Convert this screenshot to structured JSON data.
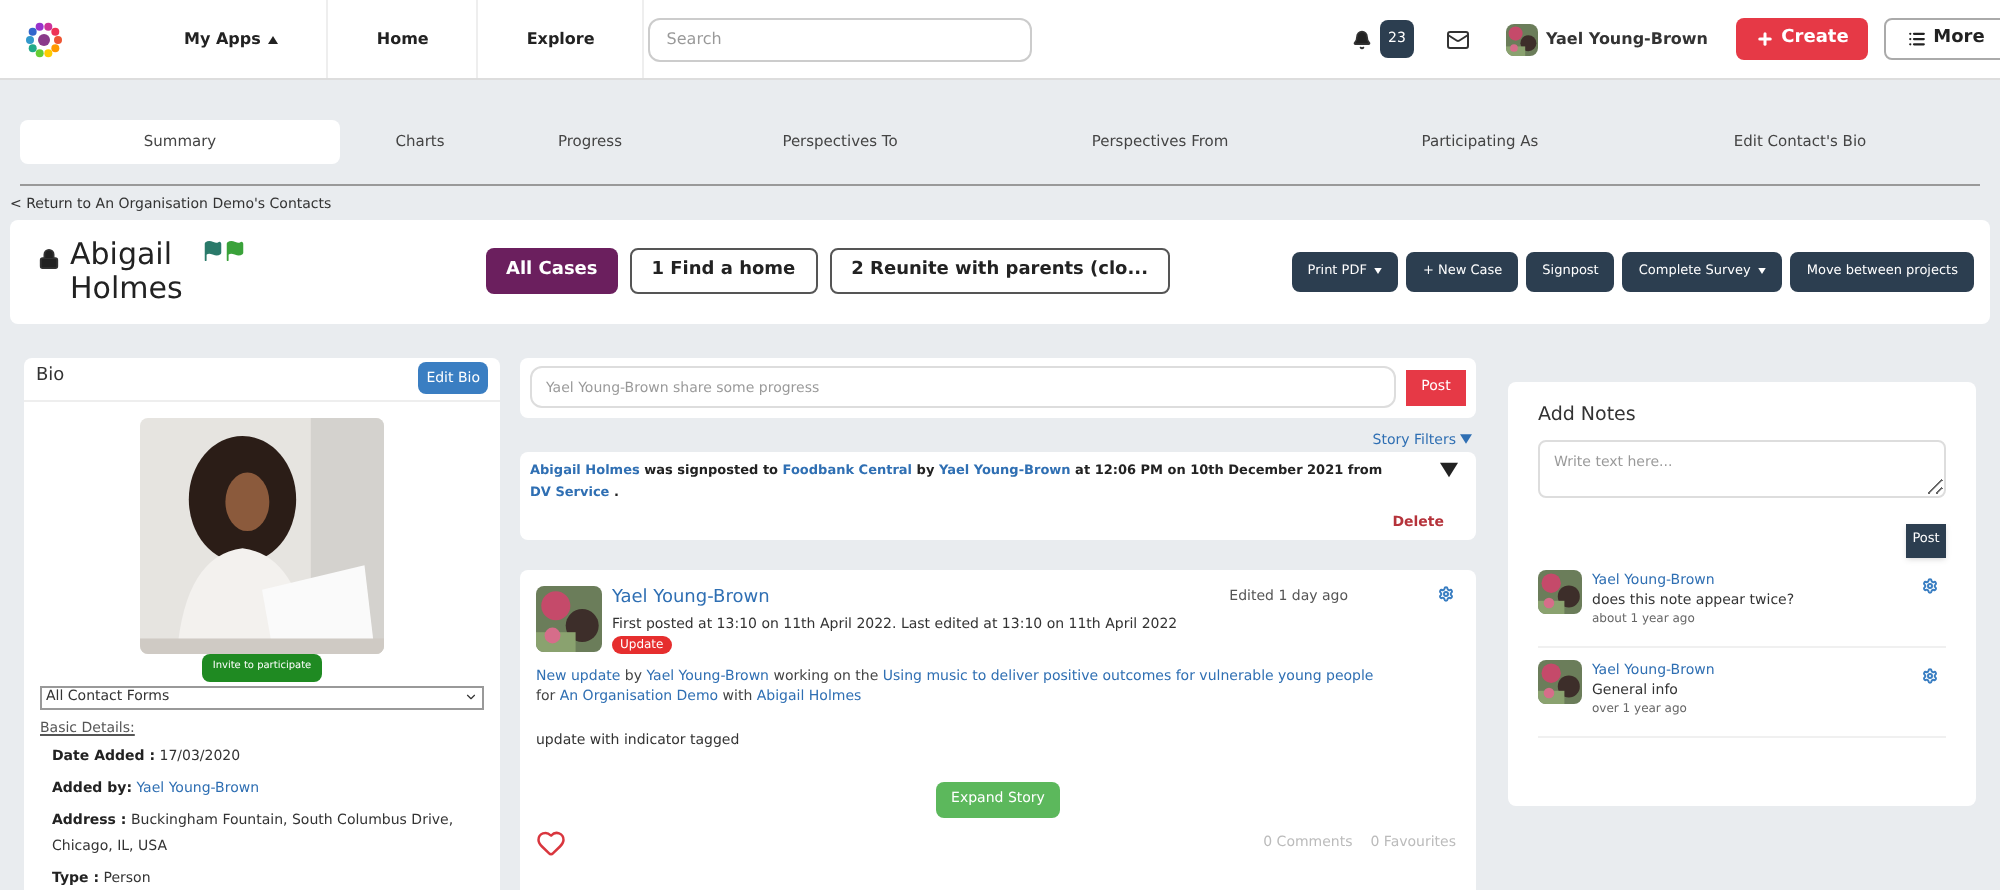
{
  "topbar": {
    "nav": [
      {
        "label": "My Apps",
        "caret": true
      },
      {
        "label": "Home",
        "caret": false
      },
      {
        "label": "Explore",
        "caret": false
      }
    ],
    "search": {
      "placeholder": "Search"
    },
    "notifications": "23",
    "user": "Yael Young-Brown",
    "create": "Create",
    "more": "More"
  },
  "tabs": [
    {
      "label": "Summary",
      "selected": true
    },
    {
      "label": "Charts",
      "selected": false
    },
    {
      "label": "Progress",
      "selected": false
    },
    {
      "label": "Perspectives To",
      "selected": false
    },
    {
      "label": "Perspectives From",
      "selected": false
    },
    {
      "label": "Participating As",
      "selected": false
    },
    {
      "label": "Edit Contact's Bio",
      "selected": false
    }
  ],
  "back_link": "< Return to An Organisation Demo's Contacts",
  "contact": {
    "name": "Abigail Holmes",
    "cases": [
      {
        "label": "All Cases",
        "selected": true
      },
      {
        "label": "1 Find a home",
        "selected": false
      },
      {
        "label": "2 Reunite with parents (clo...",
        "selected": false
      }
    ],
    "actions": [
      {
        "label": "Print PDF",
        "caret": true
      },
      {
        "label": "+ New Case",
        "caret": false
      },
      {
        "label": "Signpost",
        "caret": false
      },
      {
        "label": "Complete Survey",
        "caret": true
      },
      {
        "label": "Move between projects",
        "caret": false
      }
    ]
  },
  "bio": {
    "title": "Bio",
    "edit": "Edit Bio",
    "invite": "Invite to participate",
    "forms": "All Contact Forms",
    "section": "Basic Details:",
    "details": [
      {
        "label": "Date Added :",
        "value": "17/03/2020",
        "link": false
      },
      {
        "label": "Added by:",
        "value": "Yael Young-Brown",
        "link": true
      },
      {
        "label": "Address :",
        "value": "Buckingham Fountain, South Columbus Drive, Chicago, IL, USA",
        "link": false
      },
      {
        "label": "Type :",
        "value": "Person",
        "link": false
      }
    ]
  },
  "feed": {
    "share": {
      "placeholder": "Yael Young-Brown share some progress",
      "button": "Post"
    },
    "filters": "Story Filters",
    "signpost": {
      "segments": [
        {
          "text": "Abigail Holmes",
          "link": true
        },
        {
          "text": " was signposted to ",
          "link": false
        },
        {
          "text": "Foodbank Central",
          "link": true
        },
        {
          "text": " by ",
          "link": false
        },
        {
          "text": "Yael Young-Brown",
          "link": true
        },
        {
          "text": " at 12:06 PM on 10th December 2021 from ",
          "link": false
        },
        {
          "text": "DV Service",
          "link": true
        },
        {
          "text": " .",
          "link": false
        }
      ],
      "delete": "Delete"
    },
    "story": {
      "author": "Yael Young-Brown",
      "posted": "First posted at 13:10 on 11th April 2022. Last edited at 13:10 on 11th April 2022",
      "tag": "Update",
      "edited": "Edited 1 day ago",
      "segments": [
        {
          "text": "New update",
          "link": true
        },
        {
          "text": " by ",
          "link": false
        },
        {
          "text": "Yael Young-Brown",
          "link": true
        },
        {
          "text": " working on the ",
          "link": false
        },
        {
          "text": "Using music to deliver positive outcomes for vulnerable young people",
          "link": true
        },
        {
          "text": " for ",
          "link": false
        },
        {
          "text": "An Organisation Demo",
          "link": true
        },
        {
          "text": " with ",
          "link": false
        },
        {
          "text": "Abigail Holmes",
          "link": true
        }
      ],
      "body": "update with indicator tagged",
      "expand": "Expand Story",
      "comments": "0 Comments",
      "favourites": "0 Favourites"
    }
  },
  "notes": {
    "title": "Add Notes",
    "placeholder": "Write text here...",
    "button": "Post",
    "items": [
      {
        "author": "Yael Young-Brown",
        "text": "does this note appear twice?",
        "time": "about 1 year ago"
      },
      {
        "author": "Yael Young-Brown",
        "text": "General info",
        "time": "over 1 year ago"
      }
    ]
  }
}
